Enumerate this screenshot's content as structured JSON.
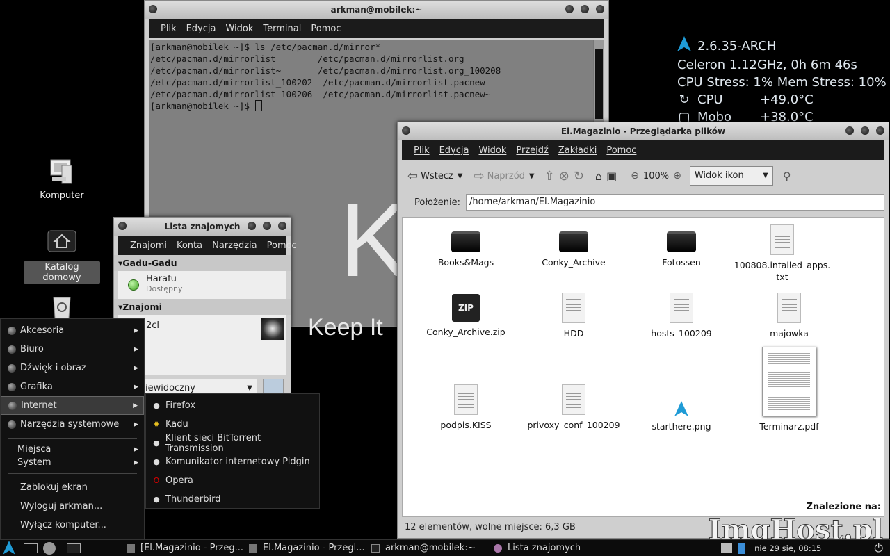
{
  "terminal": {
    "title": "arkman@mobilek:~",
    "menu": [
      "Plik",
      "Edycja",
      "Widok",
      "Terminal",
      "Pomoc"
    ],
    "lines": [
      "[arkman@mobilek ~]$ ls /etc/pacman.d/mirror*",
      "/etc/pacman.d/mirrorlist        /etc/pacman.d/mirrorlist.org",
      "/etc/pacman.d/mirrorlist~       /etc/pacman.d/mirrorlist.org_100208",
      "/etc/pacman.d/mirrorlist_100202  /etc/pacman.d/mirrorlist.pacnew",
      "/etc/pacman.d/mirrorlist_100206  /etc/pacman.d/mirrorlist.pacnew~"
    ],
    "prompt": "[arkman@mobilek ~]$ "
  },
  "wallpaper": {
    "big": "K",
    "tagline": "Keep It"
  },
  "conky": {
    "kernel": "2.6.35-ARCH",
    "cpu_info": "Celeron 1.12GHz, 0h 6m 46s",
    "stress": "CPU Stress: 1% Mem Stress: 10%",
    "cpu_label": "CPU",
    "cpu_temp": "+49.0°C",
    "mobo_label": "Mobo",
    "mobo_temp": "+38.0°C"
  },
  "desktop": {
    "computer": "Komputer",
    "home": "Katalog domowy"
  },
  "contacts": {
    "title": "Lista znajomych",
    "menu": [
      "Znajomi",
      "Konta",
      "Narzędzia",
      "Pomoc"
    ],
    "group1": "Gadu-Gadu",
    "contact1_name": "Harafu",
    "contact1_status": "Dostępny",
    "group2": "Znajomi",
    "contact2_name": "2cl",
    "status_select": "iewidoczny"
  },
  "filemanager": {
    "title": "El.Magazinio - Przeglądarka plików",
    "menu": [
      "Plik",
      "Edycja",
      "Widok",
      "Przejdź",
      "Zakładki",
      "Pomoc"
    ],
    "back": "Wstecz",
    "forward": "Naprzód",
    "zoom": "100%",
    "view_mode": "Widok ikon",
    "location_label": "Położenie:",
    "location": "/home/arkman/El.Magazinio",
    "files": [
      {
        "name": "Books&Mags",
        "kind": "folder"
      },
      {
        "name": "Conky_Archive",
        "kind": "folder"
      },
      {
        "name": "Fotossen",
        "kind": "folder"
      },
      {
        "name": "100808.intalled_apps.\ntxt",
        "kind": "doc"
      },
      {
        "name": "Conky_Archive.zip",
        "kind": "zip"
      },
      {
        "name": "HDD",
        "kind": "doc"
      },
      {
        "name": "hosts_100209",
        "kind": "doc"
      },
      {
        "name": "majowka",
        "kind": "doc"
      },
      {
        "name": "podpis.KISS",
        "kind": "doc"
      },
      {
        "name": "privoxy_conf_100209",
        "kind": "doc"
      },
      {
        "name": "starthere.png",
        "kind": "arch"
      },
      {
        "name": "Terminarz.pdf",
        "kind": "pdf"
      }
    ],
    "search_label": "Znalezione na:",
    "status": "12 elementów, wolne miejsce: 6,3 GB"
  },
  "appmenu": {
    "categories": [
      "Akcesoria",
      "Biuro",
      "Dźwięk i obraz",
      "Grafika",
      "Internet",
      "Narzędzia systemowe"
    ],
    "places": "Miejsca",
    "system": "System",
    "actions": [
      "Zablokuj ekran",
      "Wyloguj arkman...",
      "Wyłącz komputer..."
    ]
  },
  "submenu": {
    "items": [
      "Firefox",
      "Kadu",
      "Klient sieci BitTorrent Transmission",
      "Komunikator internetowy Pidgin",
      "Opera",
      "Thunderbird"
    ]
  },
  "taskbar": {
    "tasks": [
      "[El.Magazinio - Przeg...",
      "El.Magazinio - Przegl...",
      "arkman@mobilek:~",
      "Lista znajomych"
    ],
    "clock": "nie 29 sie, 08:15"
  },
  "watermark": "ImgHost.pl"
}
